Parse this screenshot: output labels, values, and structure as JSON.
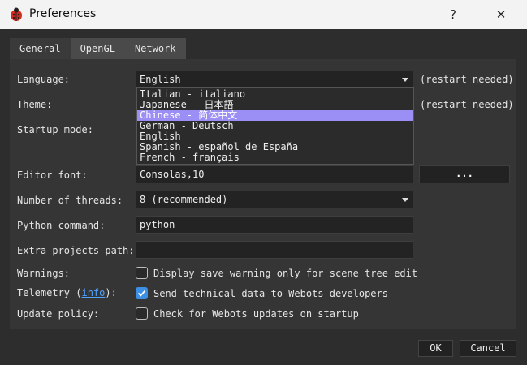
{
  "window": {
    "title": "Preferences",
    "help_glyph": "?",
    "close_glyph": "✕"
  },
  "tabs": [
    {
      "label": "General",
      "active": true
    },
    {
      "label": "OpenGL",
      "active": false
    },
    {
      "label": "Network",
      "active": false
    }
  ],
  "language": {
    "label": "Language:",
    "value": "English",
    "note": "(restart needed)",
    "options": [
      "Italian - italiano",
      "Japanese - 日本語",
      "Chinese - 简体中文",
      "German - Deutsch",
      "English",
      "Spanish - español de España",
      "French - français"
    ],
    "highlighted": "Chinese - 简体中文"
  },
  "theme": {
    "label": "Theme:",
    "note": "(restart needed)"
  },
  "startup": {
    "label": "Startup mode:"
  },
  "editor_font": {
    "label": "Editor font:",
    "value": "Consolas,10",
    "button": "..."
  },
  "threads": {
    "label": "Number of threads:",
    "value": "8 (recommended)"
  },
  "python": {
    "label": "Python command:",
    "value": "python"
  },
  "extra_path": {
    "label": "Extra projects path:",
    "value": ""
  },
  "warnings": {
    "label": "Warnings:",
    "text": "Display save warning only for scene tree edit",
    "checked": false
  },
  "telemetry": {
    "label_prefix": "Telemetry (",
    "link": "info",
    "label_suffix": "):",
    "text": "Send technical data to Webots developers",
    "checked": true
  },
  "update_policy": {
    "label": "Update policy:",
    "text": "Check for Webots updates on startup",
    "checked": false
  },
  "buttons": {
    "ok": "OK",
    "cancel": "Cancel"
  },
  "colors": {
    "accent": "#9b8ff5",
    "checkbox_on": "#3b8fe4",
    "link": "#4fa3ff"
  }
}
